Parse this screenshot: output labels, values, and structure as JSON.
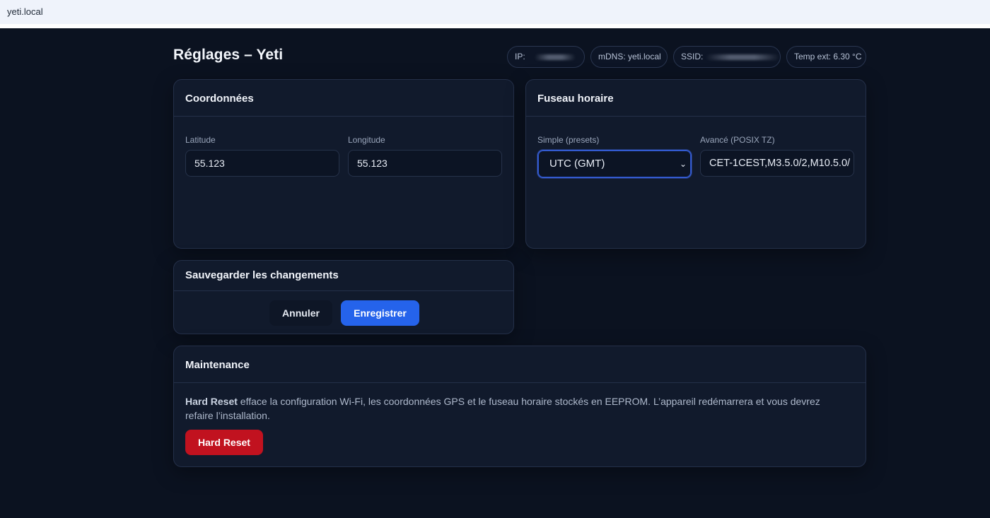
{
  "browser": {
    "address": "yeti.local"
  },
  "header": {
    "title": "Réglages – Yeti"
  },
  "status": {
    "ip_label": "IP:",
    "mdns": "mDNS: yeti.local",
    "ssid_label": "SSID:",
    "temp": "Temp ext: 6.30 °C"
  },
  "coords": {
    "title": "Coordonnées",
    "lat_label": "Latitude",
    "lat_value": "55.123",
    "lon_label": "Longitude",
    "lon_value": "55.123"
  },
  "timezone": {
    "title": "Fuseau horaire",
    "simple_label": "Simple (presets)",
    "simple_value": "UTC (GMT)",
    "advanced_label": "Avancé (POSIX TZ)",
    "advanced_value": "CET-1CEST,M3.5.0/2,M10.5.0/"
  },
  "save": {
    "title": "Sauvegarder les changements",
    "cancel_label": "Annuler",
    "save_label": "Enregistrer"
  },
  "maintenance": {
    "title": "Maintenance",
    "text_bold": "Hard Reset",
    "text": " efface la configuration Wi-Fi, les coordonnées GPS et le fuseau horaire stockés en EEPROM. L’appareil redémarrera et vous devrez refaire l’installation.",
    "button_label": "Hard Reset"
  },
  "colors": {
    "background": "#0b1220",
    "card": "#111a2c",
    "primary": "#2563eb",
    "danger": "#c1121f"
  }
}
